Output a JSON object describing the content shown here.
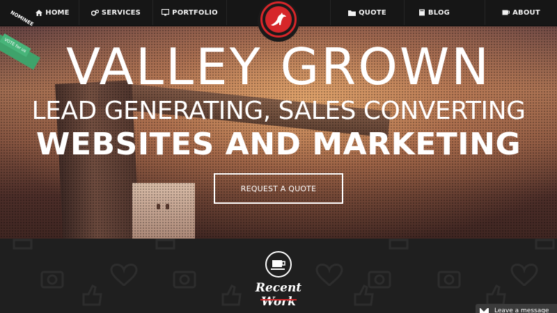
{
  "nav": {
    "home": "HOME",
    "services": "SERVICES",
    "portfolio": "PORTFOLIO",
    "quote": "QUOTE",
    "blog": "BLOG",
    "about": "ABOUT"
  },
  "ribbon": {
    "nominee": "NOMINEE",
    "vote": "VOTE for us"
  },
  "hero": {
    "headline": "VALLEY GROWN",
    "subheadline": "LEAD GENERATING, SALES CONVERTING",
    "tagline": "WEBSITES AND MARKETING",
    "cta_label": "REQUEST A QUOTE"
  },
  "recent_work": {
    "title": "Recent Work"
  },
  "chat": {
    "label": "Leave a message"
  },
  "colors": {
    "accent": "#d6262a",
    "nav_bg": "#161616",
    "ribbon": "#3fa36b"
  }
}
